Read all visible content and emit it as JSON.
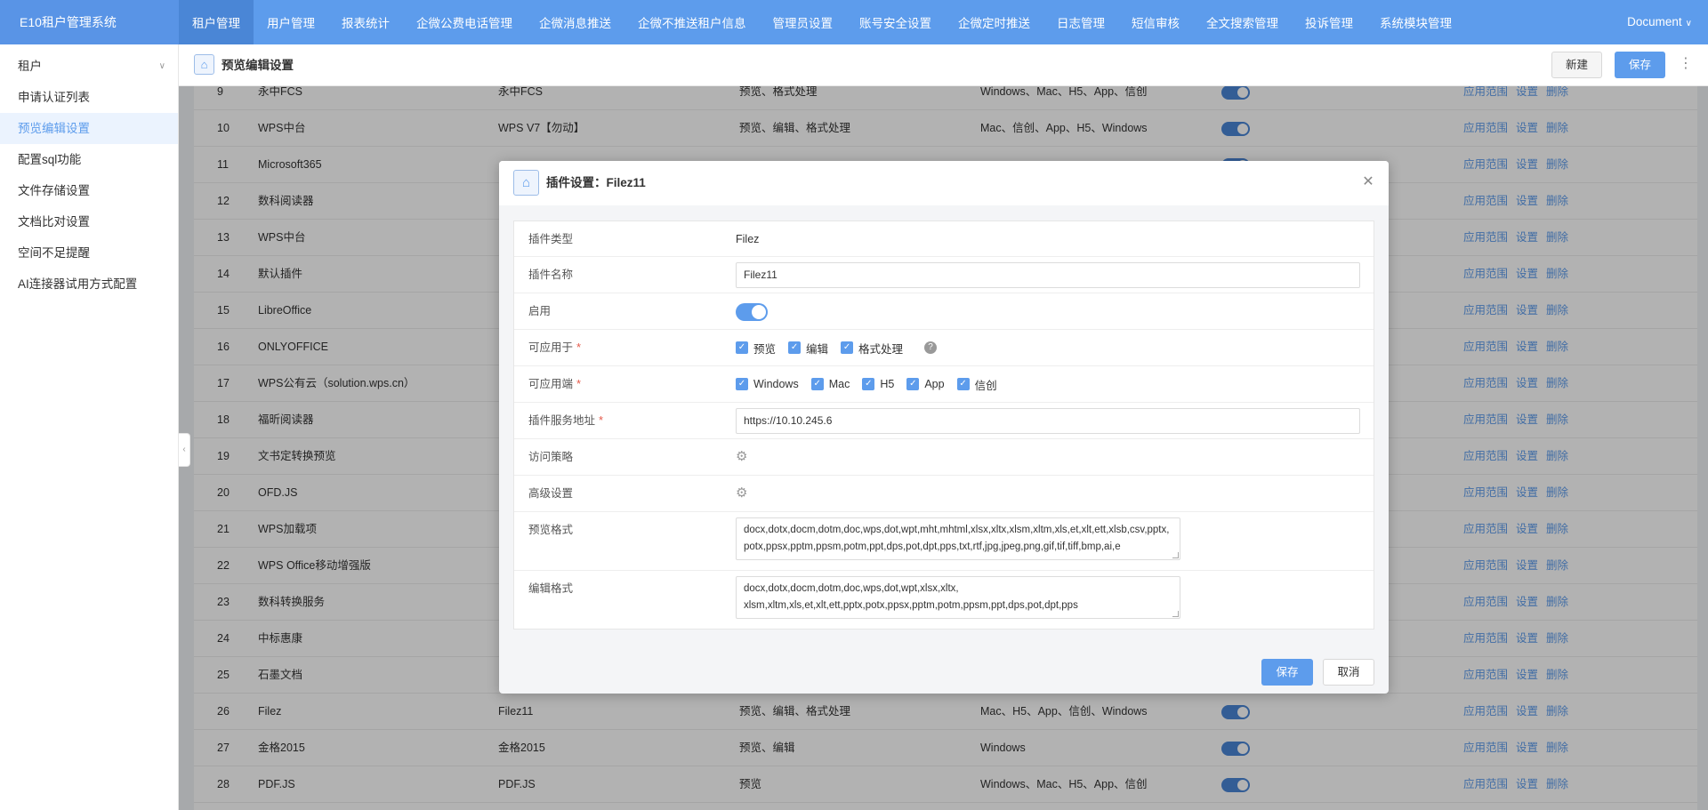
{
  "app": {
    "title": "E10租户管理系统",
    "user_menu": "Document"
  },
  "nav": {
    "items": [
      {
        "label": "租户管理",
        "active": true
      },
      {
        "label": "用户管理"
      },
      {
        "label": "报表统计"
      },
      {
        "label": "企微公费电话管理"
      },
      {
        "label": "企微消息推送"
      },
      {
        "label": "企微不推送租户信息"
      },
      {
        "label": "管理员设置"
      },
      {
        "label": "账号安全设置"
      },
      {
        "label": "企微定时推送"
      },
      {
        "label": "日志管理"
      },
      {
        "label": "短信审核"
      },
      {
        "label": "全文搜索管理"
      },
      {
        "label": "投诉管理"
      },
      {
        "label": "系统模块管理"
      }
    ]
  },
  "sidebar": {
    "items": [
      {
        "label": "租户"
      },
      {
        "label": "申请认证列表"
      },
      {
        "label": "预览编辑设置",
        "active": true
      },
      {
        "label": "配置sql功能"
      },
      {
        "label": "文件存储设置"
      },
      {
        "label": "文档比对设置"
      },
      {
        "label": "空间不足提醒"
      },
      {
        "label": "AI连接器试用方式配置"
      }
    ]
  },
  "page": {
    "title": "预览编辑设置",
    "new_label": "新建",
    "save_label": "保存"
  },
  "table": {
    "action_labels": [
      "应用范围",
      "设置",
      "删除"
    ],
    "rows": [
      {
        "no": "9",
        "name": "永中FCS",
        "plugin": "永中FCS",
        "ops": "预览、格式处理",
        "platforms": "Windows、Mac、H5、App、信创",
        "enabled": true
      },
      {
        "no": "10",
        "name": "WPS中台",
        "plugin": "WPS V7【勿动】",
        "ops": "预览、编辑、格式处理",
        "platforms": "Mac、信创、App、H5、Windows",
        "enabled": true
      },
      {
        "no": "11",
        "name": "Microsoft365"
      },
      {
        "no": "12",
        "name": "数科阅读器"
      },
      {
        "no": "13",
        "name": "WPS中台"
      },
      {
        "no": "14",
        "name": "默认插件"
      },
      {
        "no": "15",
        "name": "LibreOffice"
      },
      {
        "no": "16",
        "name": "ONLYOFFICE"
      },
      {
        "no": "17",
        "name": "WPS公有云（solution.wps.cn）"
      },
      {
        "no": "18",
        "name": "福昕阅读器"
      },
      {
        "no": "19",
        "name": "文书定转换预览"
      },
      {
        "no": "20",
        "name": "OFD.JS"
      },
      {
        "no": "21",
        "name": "WPS加载项"
      },
      {
        "no": "22",
        "name": "WPS Office移动增强版"
      },
      {
        "no": "23",
        "name": "数科转换服务"
      },
      {
        "no": "24",
        "name": "中标惠康"
      },
      {
        "no": "25",
        "name": "石墨文档"
      },
      {
        "no": "26",
        "name": "Filez",
        "plugin": "Filez11",
        "ops": "预览、编辑、格式处理",
        "platforms": "Mac、H5、App、信创、Windows",
        "enabled": true
      },
      {
        "no": "27",
        "name": "金格2015",
        "plugin": "金格2015",
        "ops": "预览、编辑",
        "platforms": "Windows",
        "enabled": true
      },
      {
        "no": "28",
        "name": "PDF.JS",
        "plugin": "PDF.JS",
        "ops": "预览",
        "platforms": "Windows、Mac、H5、App、信创",
        "enabled": true
      }
    ]
  },
  "modal": {
    "title": "插件设置：Filez11",
    "fields": {
      "type": {
        "label": "插件类型",
        "value": "Filez"
      },
      "name": {
        "label": "插件名称",
        "value": "Filez11"
      },
      "enabled": {
        "label": "启用",
        "value": true
      },
      "apply_to": {
        "label": "可应用于",
        "options": [
          "预览",
          "编辑",
          "格式处理"
        ]
      },
      "platforms": {
        "label": "可应用端",
        "options": [
          "Windows",
          "Mac",
          "H5",
          "App",
          "信创"
        ]
      },
      "service_url": {
        "label": "插件服务地址",
        "value": "https://10.10.245.6"
      },
      "access_policy": {
        "label": "访问策略"
      },
      "advanced": {
        "label": "高级设置"
      },
      "preview_formats": {
        "label": "预览格式",
        "value": "docx,dotx,docm,dotm,doc,wps,dot,wpt,mht,mhtml,xlsx,xltx,xlsm,xltm,xls,et,xlt,ett,xlsb,csv,pptx,potx,ppsx,pptm,ppsm,potm,ppt,dps,pot,dpt,pps,txt,rtf,jpg,jpeg,png,gif,tif,tiff,bmp,ai,e"
      },
      "edit_formats": {
        "label": "编辑格式",
        "value": "docx,dotx,docm,dotm,doc,wps,dot,wpt,xlsx,xltx,\nxlsm,xltm,xls,et,xlt,ett,pptx,potx,ppsx,pptm,potm,ppsm,ppt,dps,pot,dpt,pps"
      }
    },
    "save_label": "保存",
    "cancel_label": "取消"
  }
}
